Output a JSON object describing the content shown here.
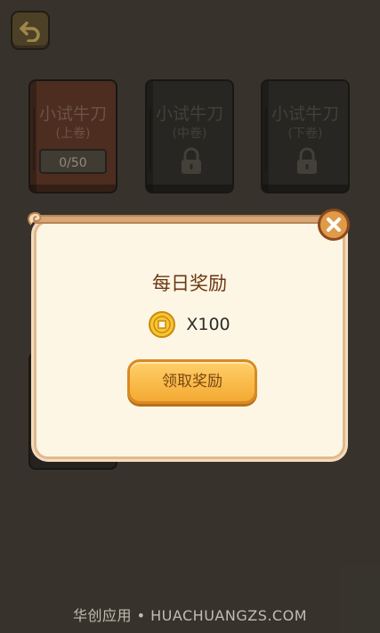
{
  "books": [
    {
      "title": "小试牛刀",
      "subtitle": "(上卷)",
      "progress": "0/50",
      "locked": false
    },
    {
      "title": "小试牛刀",
      "subtitle": "(中卷)",
      "locked": true
    },
    {
      "title": "小试牛刀",
      "subtitle": "(下卷)",
      "locked": true
    }
  ],
  "modal": {
    "title": "每日奖励",
    "reward_amount": "X100",
    "reward_icon": "coin-icon",
    "claim_label": "领取奖励",
    "close_icon": "close-icon"
  },
  "watermark": "华创应用 • HUACHUANGZS.COM",
  "colors": {
    "accent": "#f4aa33",
    "title": "#6b3712",
    "modal_bg": "#fdf6e4"
  }
}
